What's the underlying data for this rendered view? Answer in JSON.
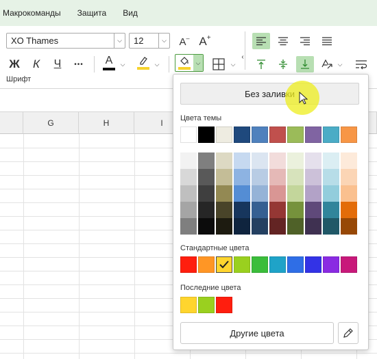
{
  "menu": {
    "items": [
      "Макрокоманды",
      "Защита",
      "Вид"
    ]
  },
  "ribbon": {
    "font_name": "XO Thames",
    "font_size": "12",
    "group_label": "Шрифт",
    "bold": "Ж",
    "italic": "К",
    "underline": "Ч",
    "more": "•••",
    "font_color_letter": "A",
    "grow": "A",
    "shrink": "A",
    "colors": {
      "font_color_bar": "#111111",
      "highlight_bar": "#f6d32d",
      "fill_bar": "#f6d32d",
      "selected_bg": "#b8dfb3"
    }
  },
  "sheet": {
    "columns": [
      "G",
      "H",
      "I"
    ]
  },
  "fill_popup": {
    "no_fill_label": "Без заливки",
    "theme_title": "Цвета темы",
    "theme_colors": [
      "#ffffff",
      "#000000",
      "#eeece1",
      "#1f497d",
      "#4f81bd",
      "#c0504d",
      "#9bbb59",
      "#8064a2",
      "#4bacc6",
      "#f79646"
    ],
    "theme_shades": [
      [
        "#f2f2f2",
        "#d8d8d8",
        "#bfbfbf",
        "#a5a5a5",
        "#7f7f7f"
      ],
      [
        "#7f7f7f",
        "#595959",
        "#3f3f3f",
        "#262626",
        "#0c0c0c"
      ],
      [
        "#ddd9c3",
        "#c4bd97",
        "#938953",
        "#494429",
        "#1d1b10"
      ],
      [
        "#c6d9f0",
        "#8db3e2",
        "#548dd4",
        "#17365d",
        "#0f243e"
      ],
      [
        "#dbe5f1",
        "#b8cce4",
        "#95b3d7",
        "#366092",
        "#244061"
      ],
      [
        "#f2dcdb",
        "#e5b9b7",
        "#d99694",
        "#953734",
        "#632423"
      ],
      [
        "#ebf1dd",
        "#d7e3bc",
        "#c3d69b",
        "#76923c",
        "#4f6128"
      ],
      [
        "#e5e0ec",
        "#ccc1d9",
        "#b2a2c7",
        "#5f497a",
        "#3f3151"
      ],
      [
        "#dbeef3",
        "#b7dde8",
        "#92cddc",
        "#31859b",
        "#205867"
      ],
      [
        "#fdeada",
        "#fbd5b5",
        "#fac08f",
        "#e36c09",
        "#974806"
      ]
    ],
    "standard_title": "Стандартные цвета",
    "standard_colors": [
      "#ff1e0e",
      "#ff9625",
      "#ffd52e",
      "#9ad01f",
      "#3bbd3b",
      "#1fa3c8",
      "#2f6ee6",
      "#3333e6",
      "#8a2be2",
      "#c8197a"
    ],
    "standard_selected_index": 2,
    "recent_title": "Последние цвета",
    "recent_colors": [
      "#ffd52e",
      "#9ad01f",
      "#ff1e0e"
    ],
    "more_colors_label": "Другие цвета"
  }
}
